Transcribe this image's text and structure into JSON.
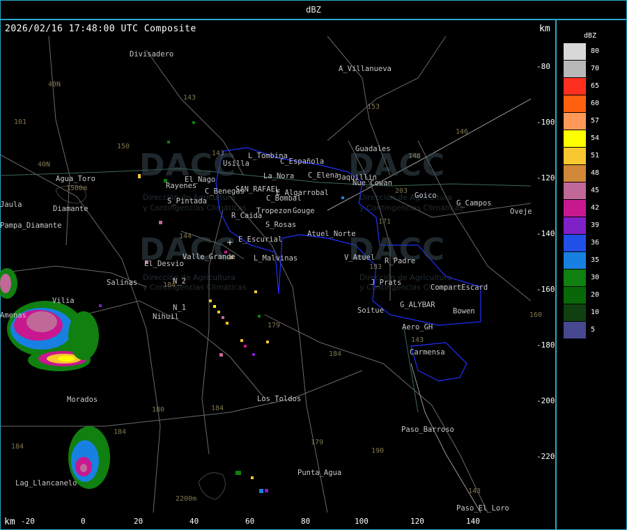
{
  "window": {
    "title": "dBZ"
  },
  "map": {
    "timestamp": "2026/02/16 17:48:00 UTC Composite",
    "unit_top": "km",
    "unit_bottom": "km",
    "x_ticks": [
      "-20",
      "0",
      "20",
      "40",
      "60",
      "80",
      "100",
      "120",
      "140"
    ],
    "y_ticks": [
      "-80",
      "-100",
      "-120",
      "-140",
      "-160",
      "-180",
      "-200",
      "-220"
    ],
    "places": [
      "Divisadero",
      "A_Villanueva",
      "Guadales",
      "L_Tombina",
      "Usilla",
      "C_Española",
      "La_Nora",
      "C_Elena",
      "Goico",
      "G_Campos",
      "Oveje",
      "Agua_Toro",
      "Diamante",
      "Jaula",
      "Pampa_Diamante",
      "Rayenes",
      "El_Nago",
      "C_Benegas",
      "SAN_RAFAEL",
      "E_Algarrobal",
      "C_Bombal",
      "S_Pintada",
      "Tropezon",
      "Gouge",
      "R_Caida",
      "S_Rosas",
      "Atuel_Norte",
      "E_Escurial",
      "Valle_Grande",
      "L_Malvinas",
      "El_Desvio",
      "V_Atuel",
      "R_Padre",
      "Salinas",
      "J_Prats",
      "CompartEscard",
      "N_2",
      "N_1",
      "G_ALYBAR",
      "Bowen",
      "Nihuil",
      "Soitue",
      "Aero_GH",
      "Carmensa",
      "Morados",
      "Los_Toldos",
      "Paso_Barroso",
      "Punta_Agua",
      "Lag_Llancanelo",
      "Paso_El_Loro",
      "Vilia",
      "Amenas",
      "Jaquillin",
      "Nue_Cowan"
    ],
    "routes": [
      "40N",
      "101",
      "143",
      "153",
      "146",
      "150",
      "40N",
      "143",
      "148",
      "203",
      "171",
      "144",
      "183",
      "160",
      "179",
      "184",
      "184",
      "180",
      "184",
      "179",
      "190",
      "143",
      "143",
      "184",
      "184"
    ],
    "elevations": [
      "1500m",
      "2200m"
    ],
    "watermarks": {
      "name": "DACC",
      "subtitle_1": "Dirección de Agricultura",
      "subtitle_2": "y Contingencias Climáticas"
    }
  },
  "legend": {
    "title": "dBZ",
    "bins": [
      {
        "label": "80",
        "color": "#d8d8d8"
      },
      {
        "label": "70",
        "color": "#b8b8b8"
      },
      {
        "label": "65",
        "color": "#ff3020"
      },
      {
        "label": "60",
        "color": "#ff6010"
      },
      {
        "label": "57",
        "color": "#ff9858"
      },
      {
        "label": "54",
        "color": "#ffff00"
      },
      {
        "label": "51",
        "color": "#f8c830"
      },
      {
        "label": "48",
        "color": "#d08838"
      },
      {
        "label": "45",
        "color": "#c06898"
      },
      {
        "label": "42",
        "color": "#c81890"
      },
      {
        "label": "39",
        "color": "#8020c8"
      },
      {
        "label": "36",
        "color": "#2050e8"
      },
      {
        "label": "35",
        "color": "#1880e0"
      },
      {
        "label": "30",
        "color": "#108010"
      },
      {
        "label": "20",
        "color": "#086808"
      },
      {
        "label": "10",
        "color": "#104010"
      },
      {
        "label": "5",
        "color": "#484890"
      }
    ]
  },
  "colors": {
    "frame": "#2aa8c8",
    "boundary": "#2030ff",
    "road": "#707070",
    "river": "#406858"
  }
}
